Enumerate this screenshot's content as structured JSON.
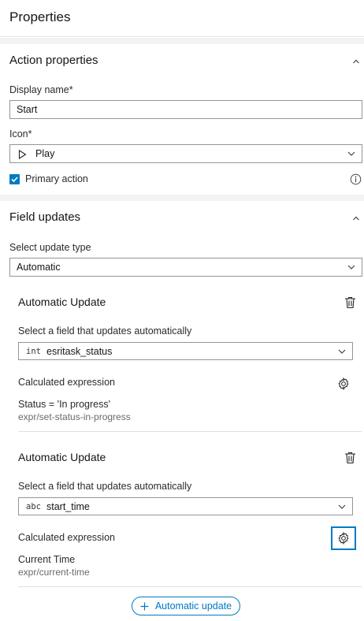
{
  "header": {
    "title": "Properties"
  },
  "action_properties": {
    "section_title": "Action properties",
    "display_name_label": "Display name*",
    "display_name_value": "Start",
    "icon_label": "Icon*",
    "icon_value": "Play",
    "primary_action_label": "Primary action",
    "primary_action_checked": true
  },
  "field_updates": {
    "section_title": "Field updates",
    "select_type_label": "Select update type",
    "select_type_value": "Automatic",
    "updates": [
      {
        "title": "Automatic Update",
        "field_label": "Select a field that updates automatically",
        "field_type": "int",
        "field_value": "esritask_status",
        "expression_label": "Calculated expression",
        "expression_title": "Status = 'In progress'",
        "expression_id": "expr/set-status-in-progress"
      },
      {
        "title": "Automatic Update",
        "field_label": "Select a field that updates automatically",
        "field_type": "abc",
        "field_value": "start_time",
        "expression_label": "Calculated expression",
        "expression_title": "Current Time",
        "expression_id": "expr/current-time"
      }
    ],
    "add_button_label": "Automatic update"
  },
  "colors": {
    "accent": "#007ac2",
    "border": "#959595",
    "band": "#f3f3f3"
  }
}
